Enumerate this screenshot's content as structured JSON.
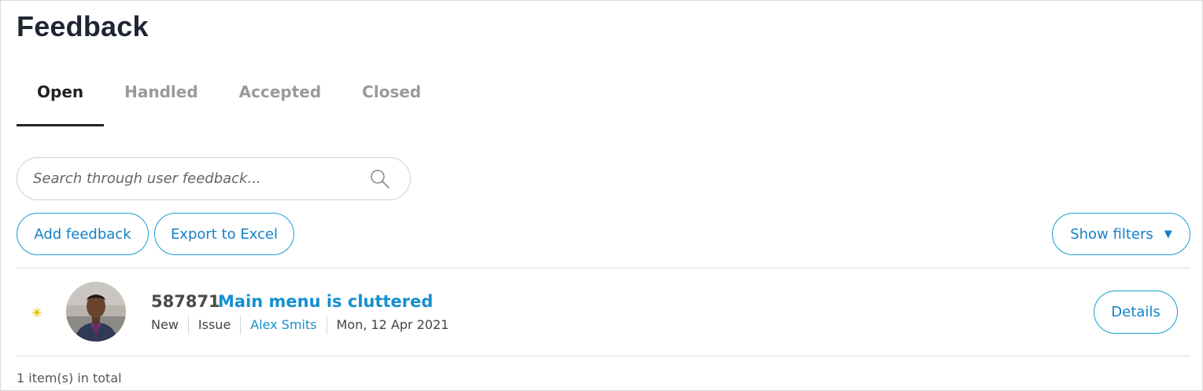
{
  "page": {
    "title": "Feedback"
  },
  "tabs": [
    {
      "label": "Open",
      "active": true
    },
    {
      "label": "Handled",
      "active": false
    },
    {
      "label": "Accepted",
      "active": false
    },
    {
      "label": "Closed",
      "active": false
    }
  ],
  "search": {
    "placeholder": "Search through user feedback...",
    "value": "",
    "icon": "search-icon"
  },
  "toolbar": {
    "add_label": "Add feedback",
    "export_label": "Export to Excel",
    "filters_label": "Show filters",
    "filters_caret": "▼"
  },
  "feedback_items": [
    {
      "id": "587871",
      "title": "Main menu is cluttered",
      "status": "New",
      "type": "Issue",
      "author": "Alex Smits",
      "date": "Mon, 12 Apr 2021",
      "details_label": "Details",
      "new_indicator_color": "#e8c400"
    }
  ],
  "footer": {
    "total_text": "1 item(s) in total"
  },
  "colors": {
    "accent": "#1590d0",
    "border": "#1a9ad6",
    "title": "#1f2533"
  }
}
